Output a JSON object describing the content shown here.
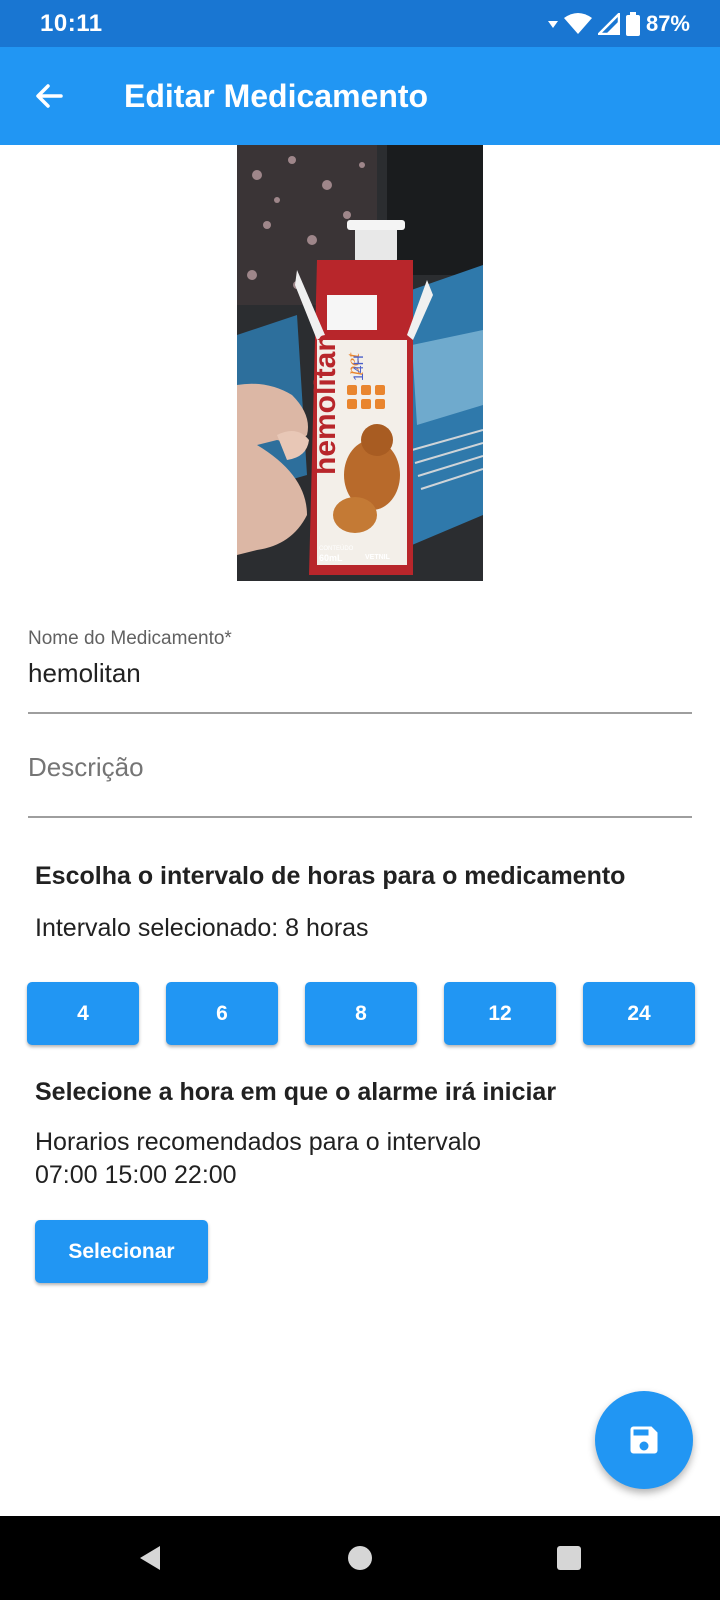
{
  "status_bar": {
    "time": "10:11",
    "battery": "87%",
    "icons": [
      "wifi-icon",
      "signal-icon",
      "battery-icon"
    ]
  },
  "app_bar": {
    "title": "Editar Medicamento",
    "back_icon": "arrow-back-icon"
  },
  "photo": {
    "brand": "hemolitan",
    "sub": "pet",
    "handwritten": "14H",
    "content_label": "CONTEÚDO",
    "volume": "60mL",
    "maker": "VETNIL"
  },
  "form": {
    "name_label": "Nome do Medicamento*",
    "name_value": "hemolitan",
    "description_placeholder": "Descrição"
  },
  "interval": {
    "heading": "Escolha o intervalo de horas para o medicamento",
    "selected_text": "Intervalo selecionado: 8 horas",
    "options": [
      "4",
      "6",
      "8",
      "12",
      "24"
    ]
  },
  "alarm": {
    "heading": "Selecione a hora em que o alarme irá iniciar",
    "recommended_label": "Horarios recomendados para o intervalo",
    "recommended_times": "07:00 15:00 22:00",
    "select_button": "Selecionar"
  },
  "fab_icon": "save-icon",
  "colors": {
    "primary": "#2196f3",
    "status_bar": "#1976d2",
    "nav_bar": "#000000"
  }
}
